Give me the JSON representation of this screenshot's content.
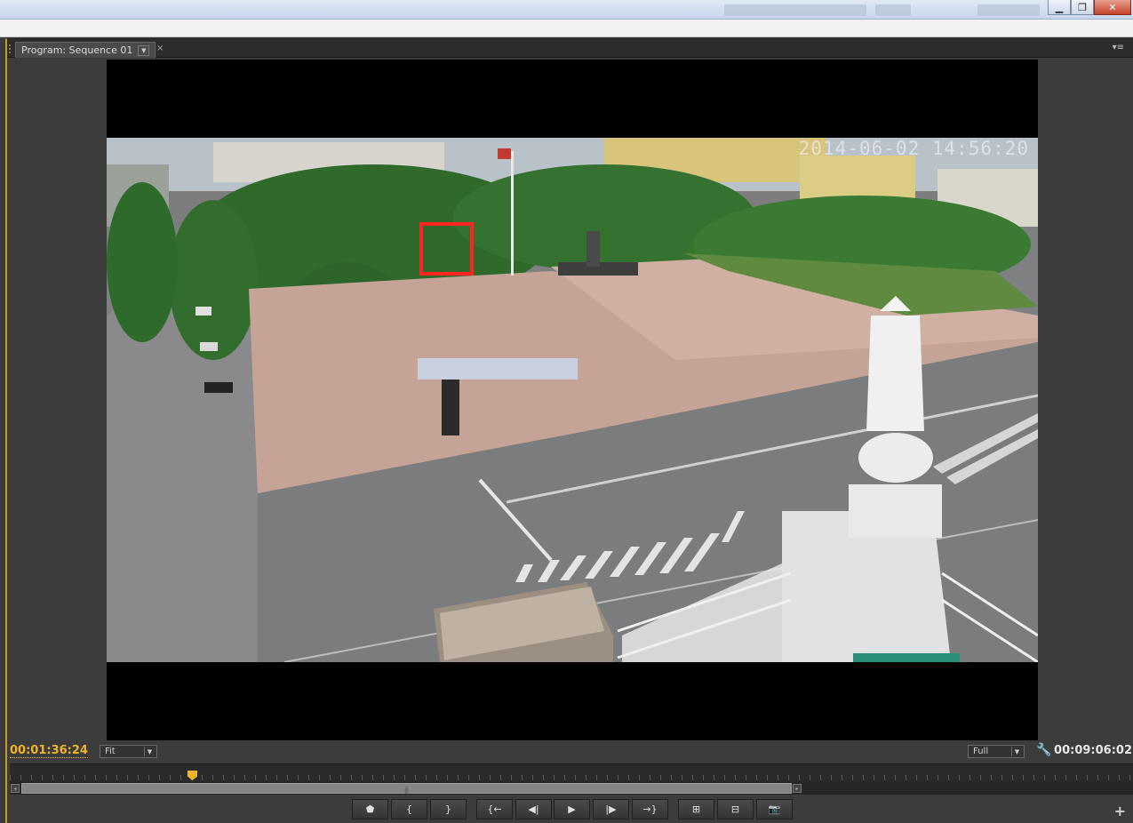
{
  "window": {
    "controls": {
      "minimize": "▁",
      "maximize": "❐",
      "close": "✕"
    }
  },
  "panel": {
    "tab_label": "Program: Sequence 01",
    "tab_dropdown": "▼",
    "tab_close": "×",
    "panel_menu": "▾≡"
  },
  "video": {
    "timestamp_overlay": "2014-06-02 14:56:20",
    "highlight_color": "#ff2424"
  },
  "timecode": {
    "current": "00:01:36:24",
    "duration": "00:09:06:02",
    "current_color": "#f0b428"
  },
  "controls": {
    "zoom_select": "Fit",
    "resolution_select": "Full",
    "select_arrow": "▼",
    "wrench": "🔧",
    "scroll_left": "◂",
    "scroll_right": "▸",
    "thumb_grip": "|||"
  },
  "transport": [
    {
      "name": "add-marker-button",
      "glyph": "⬟"
    },
    {
      "name": "mark-in-button",
      "glyph": "{"
    },
    {
      "name": "mark-out-button",
      "glyph": "}"
    },
    {
      "name": "go-to-in-button",
      "glyph": "{←"
    },
    {
      "name": "step-back-button",
      "glyph": "◀|"
    },
    {
      "name": "play-button",
      "glyph": "▶"
    },
    {
      "name": "step-forward-button",
      "glyph": "|▶"
    },
    {
      "name": "go-to-out-button",
      "glyph": "→}"
    },
    {
      "name": "insert-button",
      "glyph": "⊞"
    },
    {
      "name": "overwrite-button",
      "glyph": "⊟"
    },
    {
      "name": "export-frame-button",
      "glyph": "📷"
    }
  ],
  "add_button": "+"
}
